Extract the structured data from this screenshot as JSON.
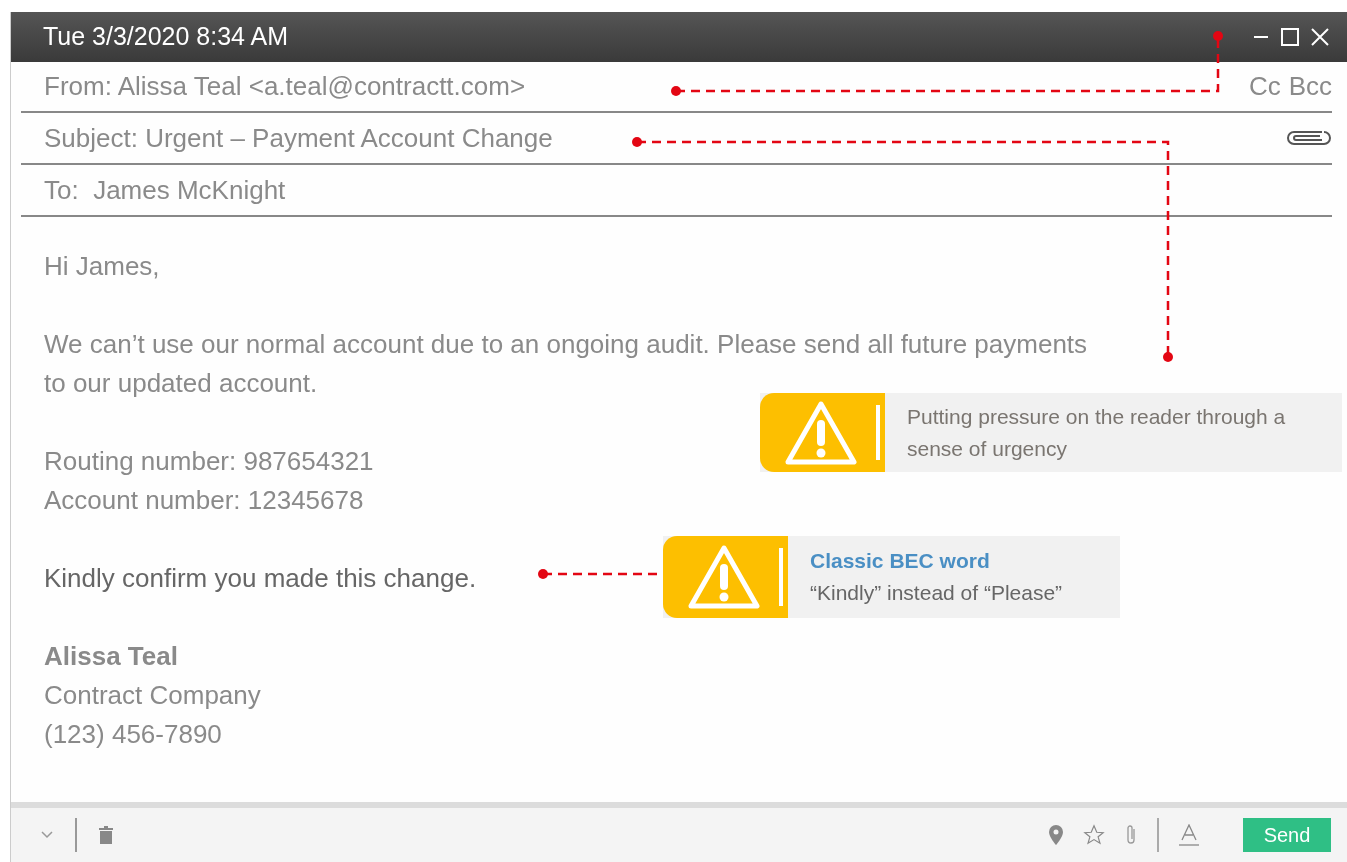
{
  "window": {
    "title": "Tue 3/3/2020 8:34 AM"
  },
  "header": {
    "from": "From: Alissa Teal <a.teal@contractt.com>",
    "cc": "Cc",
    "bcc": "Bcc",
    "subject": "Subject: Urgent – Payment Account Change",
    "to": "To:  James McKnight"
  },
  "body": {
    "paragraphs": [
      [
        "Hi James,"
      ],
      [
        "We can’t use our normal account due to an ongoing audit. Please send all future payments to our updated account."
      ],
      [
        "Routing number: 987654321",
        "Account number: 12345678"
      ],
      [
        "Kindly confirm you made this change."
      ]
    ],
    "signature": {
      "name": "Alissa Teal",
      "lines": [
        "Contract Company",
        "(123) 456-7890"
      ]
    }
  },
  "callouts": [
    {
      "text": "Putting pressure on the reader through a sense of urgency"
    },
    {
      "title": "Classic BEC word",
      "text": "“Kindly” instead of “Please”"
    }
  ],
  "toolbar": {
    "send": "Send"
  }
}
